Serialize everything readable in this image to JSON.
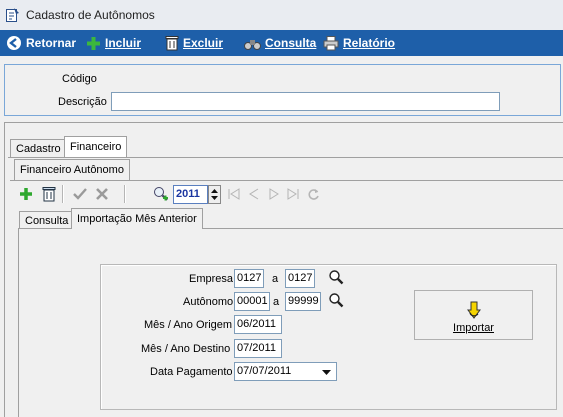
{
  "window": {
    "title": "Cadastro de Autônomos"
  },
  "toolbar": {
    "retornar": "Retornar",
    "incluir": "Incluir",
    "excluir": "Excluir",
    "consulta": "Consulta",
    "relatorio": "Relatório"
  },
  "header": {
    "codigo_label": "Código",
    "codigo_value": "",
    "descricao_label": "Descrição",
    "descricao_value": ""
  },
  "tabs": {
    "main": [
      "Cadastro",
      "Financeiro"
    ],
    "sub": [
      "Financeiro Autônomo"
    ],
    "inner": [
      "Consulta",
      "Importação Mês Anterior"
    ]
  },
  "subtoolbar": {
    "year": "2011"
  },
  "form": {
    "empresa_label": "Empresa",
    "empresa_from": "0127",
    "empresa_sep": "a",
    "empresa_to": "0127",
    "autonomo_label": "Autônomo",
    "autonomo_from": "00001",
    "autonomo_sep": "a",
    "autonomo_to": "99999",
    "mes_origem_label": "Mês / Ano Origem",
    "mes_origem_value": "06/2011",
    "mes_destino_label": "Mês / Ano Destino",
    "mes_destino_value": "07/2011",
    "data_pagamento_label": "Data Pagamento",
    "data_pagamento_value": "07/07/2011",
    "importar_label": "Importar"
  },
  "colors": {
    "toolbar_bg": "#1e5fa9",
    "panel_border": "#7aa7d8"
  }
}
